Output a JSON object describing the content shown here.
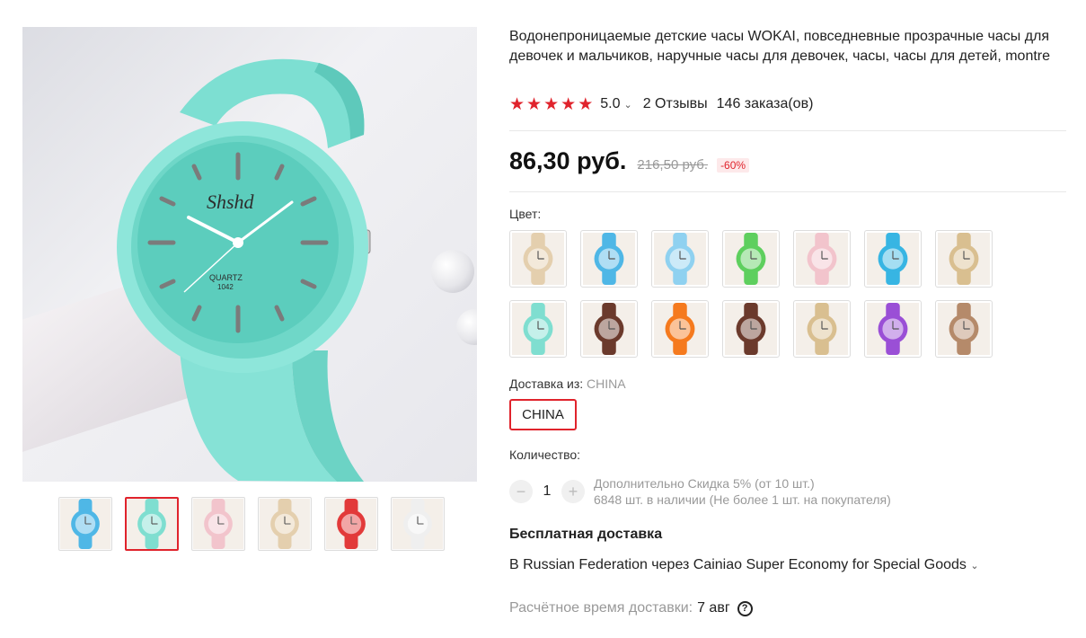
{
  "product": {
    "title": "Водонепроницаемые детские часы WOKAI, повседневные прозрачные часы для девочек и мальчиков, наручные часы для девочек, часы, часы для детей, montre",
    "rating": {
      "score": "5.0",
      "stars": 5,
      "caret": "⌄",
      "reviews": "2 Отзывы",
      "orders": "146 заказа(ов)"
    },
    "price": {
      "current": "86,30 руб.",
      "old": "216,50 руб.",
      "discount": "-60%"
    },
    "main_image": {
      "brand": "Shshd",
      "label_line1": "QUARTZ",
      "label_line2": "1042"
    }
  },
  "gallery": {
    "thumbnails": [
      {
        "icon": "blue-watch",
        "strap": "#4fb7e6",
        "active": false
      },
      {
        "icon": "mint-watch",
        "strap": "#7fded0",
        "active": true
      },
      {
        "icon": "pink-watch",
        "strap": "#f2c4cc",
        "active": false
      },
      {
        "icon": "beige-watch",
        "strap": "#e4cfae",
        "active": false
      },
      {
        "icon": "red-watch",
        "strap": "#e23a3a",
        "active": false
      },
      {
        "icon": "white-watch",
        "strap": "#efefef",
        "active": false
      }
    ]
  },
  "color": {
    "label": "Цвет:",
    "options": [
      {
        "icon": "beige-watch",
        "strap": "#e4cfae"
      },
      {
        "icon": "blue-watch",
        "strap": "#4fb7e6"
      },
      {
        "icon": "lightblue-watch",
        "strap": "#8fd1f0"
      },
      {
        "icon": "green-watch",
        "strap": "#5ecf5e"
      },
      {
        "icon": "pink-watch",
        "strap": "#f2c4cc"
      },
      {
        "icon": "sky-watch",
        "strap": "#37b5e3"
      },
      {
        "icon": "beige-watch",
        "strap": "#d9bf90"
      },
      {
        "icon": "mint-watch",
        "strap": "#7fded0"
      },
      {
        "icon": "brown-watch",
        "strap": "#6b3a2c"
      },
      {
        "icon": "orange-watch",
        "strap": "#f57a1e"
      },
      {
        "icon": "brown-watch",
        "strap": "#6b3a2c"
      },
      {
        "icon": "beige-watch",
        "strap": "#d9bf90"
      },
      {
        "icon": "purple-watch",
        "strap": "#9a4fd6"
      },
      {
        "icon": "tan-watch",
        "strap": "#b58a6a"
      }
    ]
  },
  "shipping_from": {
    "label": "Доставка из:",
    "value": "CHINA",
    "option": "CHINA"
  },
  "quantity": {
    "label": "Количество:",
    "minus": "−",
    "value": "1",
    "plus": "+",
    "discount_note": "Дополнительно Скидка 5% (от 10 шт.)",
    "stock_note": "6848 шт. в наличии (Не более 1 шт. на покупателя)"
  },
  "delivery": {
    "title": "Бесплатная доставка",
    "method": "В Russian Federation через Cainiao Super Economy for Special Goods",
    "method_caret": "⌄",
    "estimate_label": "Расчётное время доставки:",
    "estimate_date": "7 авг",
    "help": "?"
  },
  "colors": {
    "accent": "#e0232c",
    "muted": "#999999"
  }
}
